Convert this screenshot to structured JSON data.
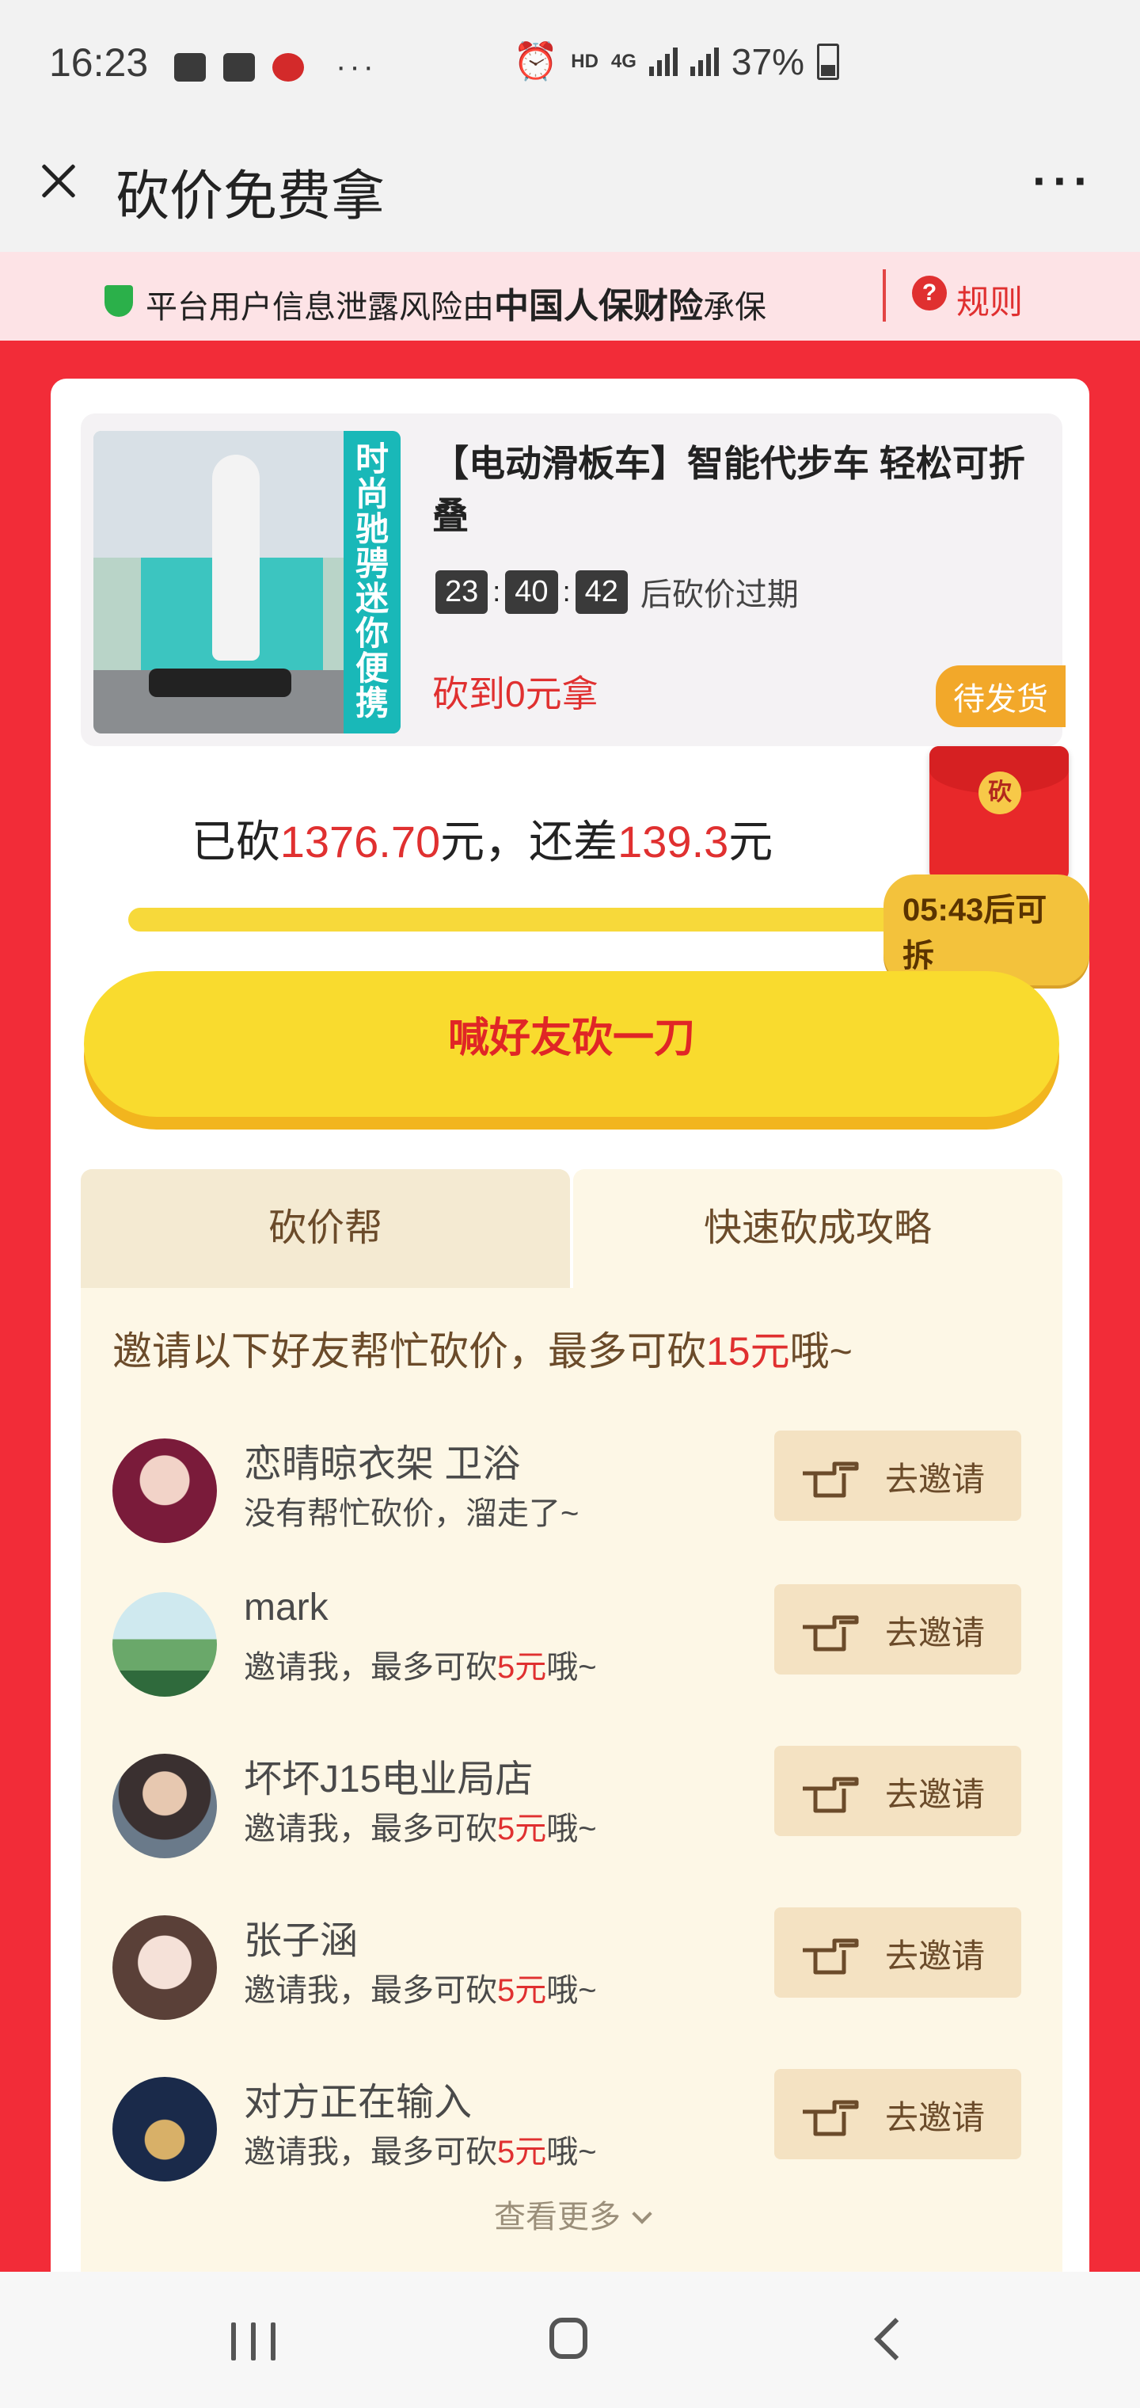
{
  "status_bar": {
    "time": "16:23",
    "network": "HD",
    "network_type": "4G",
    "battery": "37%",
    "icons": [
      "gallery-icon",
      "app-icon",
      "bank-icon",
      "more-icon",
      "alarm-icon",
      "signal-icon",
      "battery-icon"
    ]
  },
  "title_bar": {
    "title": "砍价免费拿",
    "more": "···"
  },
  "notice": {
    "prefix": "平台用户信息泄露风险由",
    "insurer": "中国人保财险",
    "suffix": "承保",
    "rules": "规则"
  },
  "product": {
    "image_strip": "时尚驰骋 迷你便携",
    "title": "【电动滑板车】智能代步车 轻松可折叠",
    "countdown": [
      "23",
      "40",
      "42"
    ],
    "countdown_sep": ":",
    "countdown_suffix": "后砍价过期",
    "price_text": "砍到0元拿",
    "status": "待发货"
  },
  "progress": {
    "cut_label": "已砍",
    "cut_amount": "1376.70",
    "mid_text": "元，还差",
    "remaining": "139.3",
    "unit": "元",
    "redpacket_char": "砍",
    "timer_text": "05:43后可拆"
  },
  "cta": {
    "label": "喊好友砍一刀"
  },
  "tabs": [
    {
      "label": "砍价帮"
    },
    {
      "label": "快速砍成攻略"
    }
  ],
  "invite": {
    "hint_prefix": "邀请以下好友帮忙砍价，最多可砍",
    "hint_amount": "15元",
    "hint_suffix": "哦~",
    "button_label": "去邀请",
    "see_more": "查看更多"
  },
  "friends": [
    {
      "name": "恋晴晾衣架 卫浴",
      "desc_plain": "没有帮忙砍价，溜走了~"
    },
    {
      "name": "mark",
      "desc_prefix": "邀请我，最多可砍",
      "desc_amount": "5元",
      "desc_suffix": "哦~"
    },
    {
      "name": "坏坏J15电业局店",
      "desc_prefix": "邀请我，最多可砍",
      "desc_amount": "5元",
      "desc_suffix": "哦~"
    },
    {
      "name": "张子涵",
      "desc_prefix": "邀请我，最多可砍",
      "desc_amount": "5元",
      "desc_suffix": "哦~"
    },
    {
      "name": "对方正在输入",
      "desc_prefix": "邀请我，最多可砍",
      "desc_amount": "5元",
      "desc_suffix": "哦~"
    }
  ],
  "colors": {
    "accent_red": "#e03030",
    "cta_yellow": "#f9db2e",
    "page_red": "#f22c38",
    "panel_cream": "#fdf7e6"
  }
}
